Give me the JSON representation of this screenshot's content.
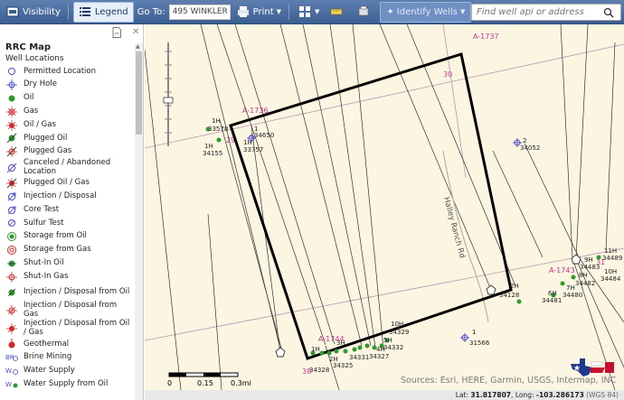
{
  "toolbar": {
    "visibility": "Visibility",
    "legend": "Legend",
    "goto_label": "Go To:",
    "goto_value": "495 WINKLER",
    "print": "Print",
    "identify": "Identify Wells",
    "search_placeholder": "Find well api or address"
  },
  "legend": {
    "title": "RRC Map",
    "subtitle": "Well Locations",
    "items": [
      {
        "label": "Permitted Location",
        "icon": "open-circle"
      },
      {
        "label": "Dry Hole",
        "icon": "dry-hole"
      },
      {
        "label": "Oil",
        "icon": "green-dot"
      },
      {
        "label": "Gas",
        "icon": "gas-star"
      },
      {
        "label": "Oil / Gas",
        "icon": "oil-gas-star"
      },
      {
        "label": "Plugged Oil",
        "icon": "plugged-oil"
      },
      {
        "label": "Plugged Gas",
        "icon": "plugged-gas"
      },
      {
        "label": "Canceled / Abandoned Location",
        "icon": "canceled-circle"
      },
      {
        "label": "Plugged Oil / Gas",
        "icon": "plugged-oil-gas"
      },
      {
        "label": "Injection / Disposal",
        "icon": "injection"
      },
      {
        "label": "Core Test",
        "icon": "core-test"
      },
      {
        "label": "Sulfur Test",
        "icon": "sulfur-test"
      },
      {
        "label": "Storage from Oil",
        "icon": "storage-oil"
      },
      {
        "label": "Storage from Gas",
        "icon": "storage-gas"
      },
      {
        "label": "Shut-In Oil",
        "icon": "shut-in-oil"
      },
      {
        "label": "Shut-In Gas",
        "icon": "shut-in-gas"
      },
      {
        "label": "Injection / Disposal from Oil",
        "icon": "inj-oil"
      },
      {
        "label": "Injection / Disposal from Gas",
        "icon": "inj-gas"
      },
      {
        "label": "Injection / Disposal from Oil / Gas",
        "icon": "inj-oil-gas"
      },
      {
        "label": "Geothermal",
        "icon": "geothermal"
      },
      {
        "label": "Brine Mining",
        "icon": "brine"
      },
      {
        "label": "Water Supply",
        "icon": "water-supply"
      },
      {
        "label": "Water Supply from Oil",
        "icon": "water-supply-oil"
      }
    ]
  },
  "map": {
    "sections": [
      "A-1736",
      "A-1737",
      "A-1743",
      "A-1744"
    ],
    "section_nums": [
      "29",
      "30",
      "31",
      "38"
    ],
    "road": "Halley Ranch Rd",
    "wells": [
      "1H",
      "33578",
      "1",
      "34650",
      "1H",
      "34155",
      "1H",
      "33757",
      "2",
      "34052",
      "9H",
      "34483",
      "11H",
      "34489",
      "10H",
      "34484",
      "8H",
      "34482",
      "7H",
      "34480",
      "6H",
      "34481",
      "2H",
      "34128",
      "1",
      "31566",
      "10H",
      "34329",
      "5H",
      "34332",
      "4H",
      "34327",
      "3H",
      "34331",
      "2H",
      "34325",
      "1H",
      "34328"
    ],
    "scale": {
      "labels": [
        "0",
        "0.15",
        "0.3mi"
      ]
    },
    "attribution": "Sources: Esri, HERE, Garmin, USGS, Intermap, INC"
  },
  "status": {
    "lat_label": "Lat:",
    "lat": "31.817807",
    "long_label": "Long:",
    "long": "-103.286173",
    "datum": "(WGS 84)"
  }
}
